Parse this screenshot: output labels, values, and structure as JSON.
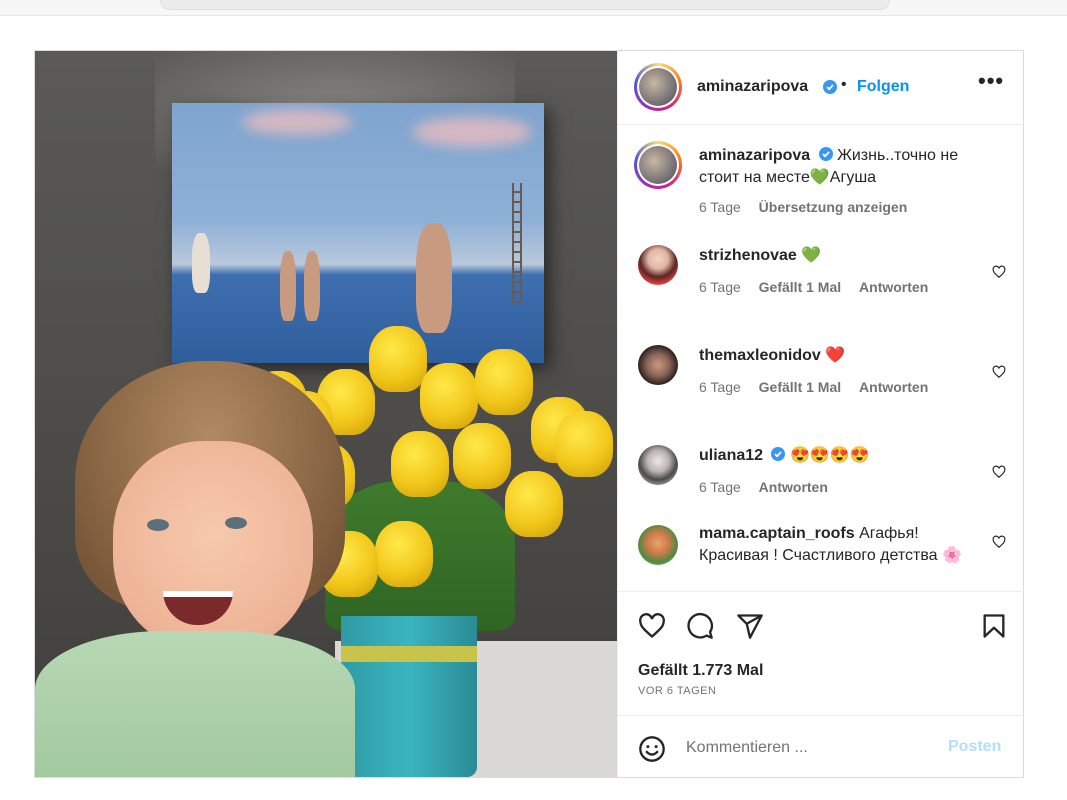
{
  "post": {
    "header": {
      "username": "aminazaripova",
      "separator": "•",
      "follow_label": "Folgen",
      "more_label": "•••"
    },
    "caption": {
      "username": "aminazaripova",
      "text": "Жизнь..точно не стоит на месте💚Агуша",
      "time": "6 Tage",
      "translate_label": "Übersetzung anzeigen"
    },
    "comments": [
      {
        "username": "strizhenovae",
        "text": "💚",
        "time": "6 Tage",
        "likes": "Gefällt 1 Mal",
        "reply_label": "Antworten",
        "verified": false
      },
      {
        "username": "themaxleonidov",
        "text": "❤️",
        "time": "6 Tage",
        "likes": "Gefällt 1 Mal",
        "reply_label": "Antworten",
        "verified": false
      },
      {
        "username": "uliana12",
        "text": "😍😍😍😍",
        "time": "6 Tage",
        "likes": "",
        "reply_label": "Antworten",
        "verified": true
      },
      {
        "username": "mama.captain_roofs",
        "text": "Агафья! Красивая ! Счастливого детства 🌸",
        "time": "",
        "likes": "",
        "reply_label": "",
        "verified": false
      }
    ],
    "likes_label": "Gefällt 1.773 Mal",
    "posted_ago": "VOR 6 TAGEN",
    "composer": {
      "placeholder": "Kommentieren ...",
      "post_label": "Posten"
    },
    "colors": {
      "accent": "#0095f6",
      "verified": "#3897f0",
      "post_disabled": "#b2dffc",
      "text": "#262626",
      "muted": "#737373"
    },
    "icons": [
      "verified-badge-icon",
      "more-icon",
      "heart-icon",
      "comment-icon",
      "share-icon",
      "bookmark-icon",
      "emoji-icon"
    ]
  }
}
